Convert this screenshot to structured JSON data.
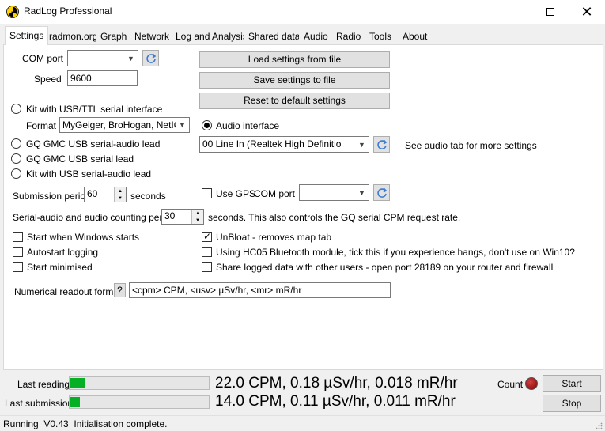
{
  "window": {
    "title": "RadLog Professional",
    "icon": "radiation-icon",
    "controls": [
      "minimize",
      "maximize",
      "close"
    ]
  },
  "tabs": [
    {
      "label": "Settings",
      "active": true
    },
    {
      "label": "radmon.org"
    },
    {
      "label": "Graph"
    },
    {
      "label": "Network"
    },
    {
      "label": "Log and Analysis"
    },
    {
      "label": "Shared data"
    },
    {
      "label": "Audio"
    },
    {
      "label": "Radio"
    },
    {
      "label": "Tools"
    },
    {
      "label": "About"
    }
  ],
  "settings": {
    "com_port": {
      "label": "COM port",
      "value": ""
    },
    "speed": {
      "label": "Speed",
      "value": "9600"
    },
    "buttons": {
      "load": "Load settings from file",
      "save": "Save settings to file",
      "reset": "Reset to default settings"
    },
    "interface_options": {
      "usb_ttl": "Kit with USB/TTL serial interface",
      "format_label": "Format",
      "format_value": "MyGeiger, BroHogan, NetIO",
      "gq_audio": "GQ GMC USB serial-audio lead",
      "gq_serial": "GQ GMC USB serial lead",
      "kit_usb_audio": "Kit with USB serial-audio lead",
      "audio_interface": "Audio interface",
      "selected": "audio_interface"
    },
    "audio_device": {
      "value": "00 Line In (Realtek High Definitio",
      "note": "See audio tab for more settings"
    },
    "submission_period": {
      "label": "Submission period",
      "value": "60",
      "unit": "seconds"
    },
    "use_gps": {
      "label": "Use GPS",
      "com_label": "COM port",
      "value": "",
      "checked": false
    },
    "counting_period": {
      "label": "Serial-audio and audio counting period",
      "value": "30",
      "suffix": "seconds. This also controls the GQ serial CPM request rate."
    },
    "checkboxes_left": [
      {
        "label": "Start when Windows starts",
        "checked": false
      },
      {
        "label": "Autostart logging",
        "checked": false
      },
      {
        "label": "Start minimised",
        "checked": false
      }
    ],
    "checkboxes_right": [
      {
        "label": "UnBloat - removes map tab",
        "checked": true
      },
      {
        "label": "Using HC05 Bluetooth module, tick this if you experience hangs, don't use on Win10?",
        "checked": false
      },
      {
        "label": "Share logged data with other users - open port 28189 on your router and firewall",
        "checked": false
      }
    ],
    "readout_format": {
      "label": "Numerical readout format",
      "help": "?",
      "value": "<cpm> CPM, <usv> µSv/hr, <mr> mR/hr"
    }
  },
  "readings": {
    "last_reading": {
      "label": "Last reading",
      "text": "22.0 CPM, 0.18 µSv/hr, 0.018 mR/hr",
      "progress": 0.11
    },
    "last_submission": {
      "label": "Last submission",
      "text": "14.0 CPM, 0.11 µSv/hr, 0.011 mR/hr",
      "progress": 0.07
    },
    "count_label": "Count",
    "count_led_color": "#8b0000",
    "start_button": "Start",
    "stop_button": "Stop"
  },
  "status": {
    "text": "Running  V0.43  Initialisation complete."
  }
}
